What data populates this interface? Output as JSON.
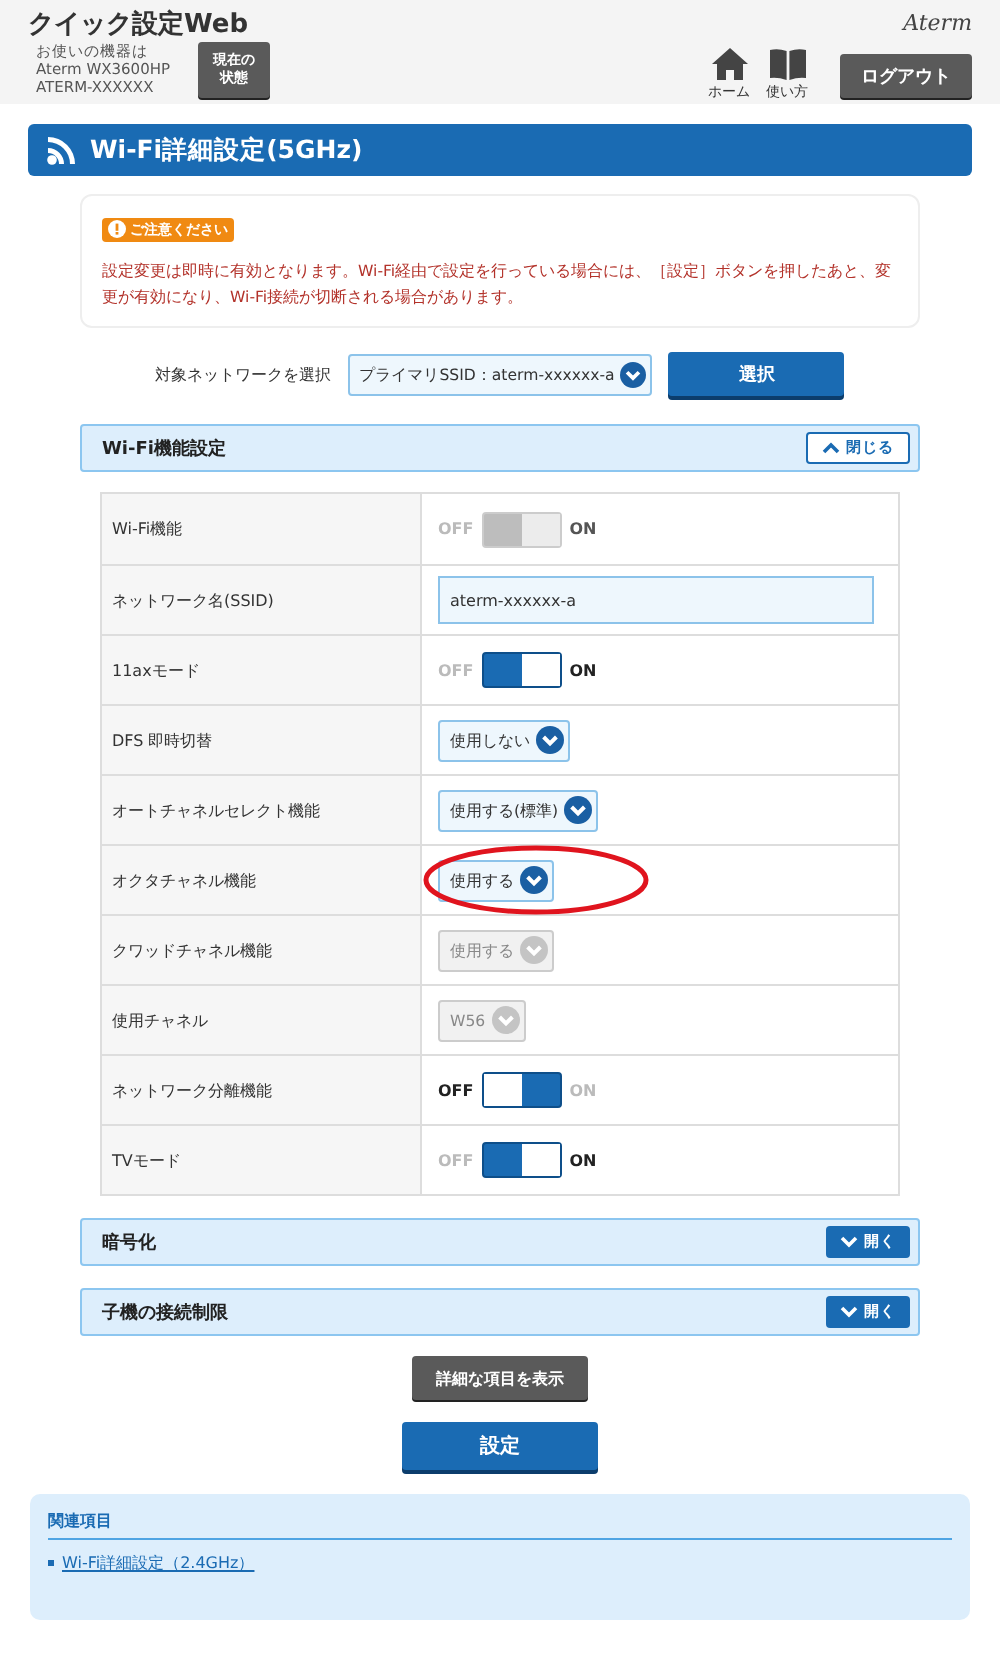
{
  "header": {
    "app_title": "クイック設定Web",
    "device_lines": [
      "お使いの機器は",
      "Aterm WX3600HP",
      "ATERM-XXXXXX"
    ],
    "status_button": "現在の状態",
    "home_label": "ホーム",
    "help_label": "使い方",
    "logout_button": "ログアウト",
    "brand": "Aterm"
  },
  "page_title": "Wi-Fi詳細設定(5GHz)",
  "notice": {
    "badge": "ご注意ください",
    "text": "設定変更は即時に有効となります。Wi-Fi経由で設定を行っている場合には、［設定］ボタンを押したあと、変更が有効になり、Wi-Fi接続が切断される場合があります。"
  },
  "network_select": {
    "label": "対象ネットワークを選択",
    "value": "プライマリSSID：aterm-xxxxxx-a",
    "button": "選択"
  },
  "sections": [
    {
      "title": "Wi-Fi機能設定",
      "expanded": true,
      "toggle_label": "閉じる"
    }
  ],
  "settings": [
    {
      "label": "Wi-Fi機能",
      "kind": "toggle",
      "on": true,
      "disabled": true,
      "off_text": "OFF",
      "on_text": "ON",
      "highlighted": false
    },
    {
      "label": "ネットワーク名(SSID)",
      "kind": "input",
      "value": "aterm-xxxxxx-a",
      "highlighted": false
    },
    {
      "label": "11axモード",
      "kind": "toggle",
      "on": true,
      "disabled": false,
      "off_text": "OFF",
      "on_text": "ON",
      "highlighted": false
    },
    {
      "label": "DFS 即時切替",
      "kind": "select",
      "value": "使用しない",
      "disabled": false,
      "highlighted": false
    },
    {
      "label": "オートチャネルセレクト機能",
      "kind": "select",
      "value": "使用する(標準)",
      "disabled": false,
      "highlighted": false
    },
    {
      "label": "オクタチャネル機能",
      "kind": "select",
      "value": "使用する",
      "disabled": false,
      "highlighted": true
    },
    {
      "label": "クワッドチャネル機能",
      "kind": "select",
      "value": "使用する",
      "disabled": true,
      "highlighted": false
    },
    {
      "label": "使用チャネル",
      "kind": "select",
      "value": "W56",
      "disabled": true,
      "highlighted": false
    },
    {
      "label": "ネットワーク分離機能",
      "kind": "toggle",
      "on": false,
      "disabled": false,
      "off_text": "OFF",
      "on_text": "ON",
      "highlighted": false
    },
    {
      "label": "TVモード",
      "kind": "toggle",
      "on": true,
      "disabled": false,
      "off_text": "OFF",
      "on_text": "ON",
      "highlighted": false
    }
  ],
  "collapsed_sections": [
    {
      "title": "暗号化",
      "expanded": false,
      "toggle_label": "開く"
    },
    {
      "title": "子機の接続制限",
      "expanded": false,
      "toggle_label": "開く"
    }
  ],
  "detail_button": "詳細な項目を表示",
  "apply_button": "設定",
  "related": {
    "title": "関連項目",
    "links": [
      "Wi-Fi詳細設定（2.4GHz）"
    ]
  }
}
